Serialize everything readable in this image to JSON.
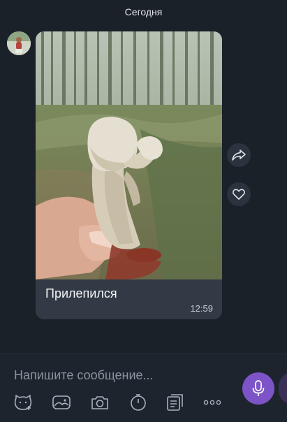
{
  "chat": {
    "date_divider": "Сегодня"
  },
  "message": {
    "caption": "Прилепился",
    "time": "12:59"
  },
  "composer": {
    "placeholder": "Напишите сообщение..."
  },
  "icons": {
    "forward": "forward-arrow-icon",
    "like": "heart-icon",
    "mic": "microphone-icon",
    "sticker": "sticker-icon",
    "gallery": "gallery-icon",
    "camera": "camera-icon",
    "timer": "timer-icon",
    "notes": "notes-icon",
    "more": "more-dots-icon"
  },
  "colors": {
    "accent": "#7d54c8",
    "background": "#1b2129",
    "bubble": "#323a45"
  }
}
